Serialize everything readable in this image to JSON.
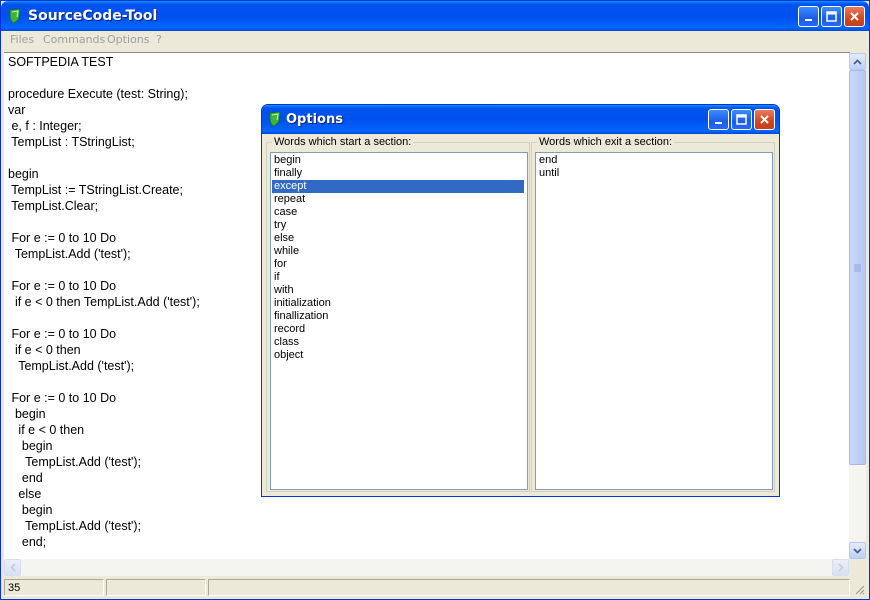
{
  "app": {
    "title": "SourceCode-Tool"
  },
  "menu": [
    "Files",
    "Commands",
    "Options",
    "?"
  ],
  "editor": {
    "lines": [
      "SOFTPEDIA TEST",
      "",
      "procedure Execute (test: String);",
      "var",
      " e, f : Integer;",
      " TempList : TStringList;",
      "",
      "begin",
      " TempList := TStringList.Create;",
      " TempList.Clear;",
      "",
      " For e := 0 to 10 Do",
      "  TempList.Add ('test');",
      "",
      " For e := 0 to 10 Do",
      "  if e < 0 then TempList.Add ('test');",
      "",
      " For e := 0 to 10 Do",
      "  if e < 0 then",
      "   TempList.Add ('test');",
      "",
      " For e := 0 to 10 Do",
      "  begin",
      "   if e < 0 then",
      "    begin",
      "     TempList.Add ('test');",
      "    end",
      "   else",
      "    begin",
      "     TempList.Add ('test');",
      "    end;"
    ]
  },
  "status": {
    "line": "35",
    "panel2": "",
    "panel3": ""
  },
  "dialog": {
    "title": "Options",
    "start_label": "Words which start a section:",
    "exit_label": "Words which exit a section:",
    "start_words": [
      "begin",
      "finally",
      "except",
      "repeat",
      "case",
      "try",
      "else",
      "while",
      "for",
      "if",
      "with",
      "initialization",
      "finallization",
      "record",
      "class",
      "object"
    ],
    "selected_start": "except",
    "exit_words": [
      "end",
      "until"
    ]
  },
  "colors": {
    "titlebar": "#0053ee",
    "selection": "#316ac5",
    "close": "#d3451f"
  }
}
